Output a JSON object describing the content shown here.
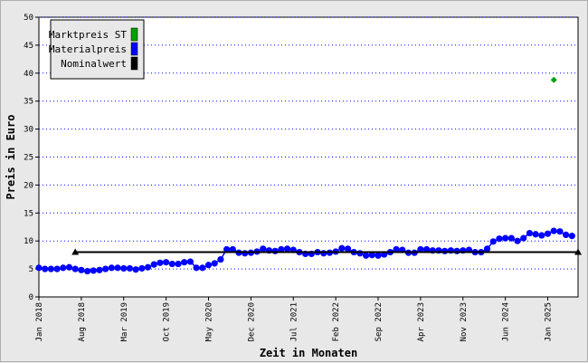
{
  "chart_data": {
    "type": "line",
    "xlabel": "Zeit in Monaten",
    "ylabel": "Preis in Euro",
    "ylim": [
      0,
      50
    ],
    "yticks": [
      0,
      5,
      10,
      15,
      20,
      25,
      30,
      35,
      40,
      45,
      50
    ],
    "grid": "horizontal dotted",
    "legend_position": "top-left",
    "x_tick_labels": [
      "Jan 2018",
      "Aug 2018",
      "Mar 2019",
      "Oct 2019",
      "May 2020",
      "Dec 2020",
      "Jul 2021",
      "Feb 2022",
      "Sep 2022",
      "Apr 2023",
      "Nov 2023",
      "Jun 2024",
      "Jan 2025"
    ],
    "x_start": "Jan 2018",
    "x_end": "Jun 2025",
    "series": [
      {
        "name": "Marktpreis ST",
        "color": "#00a000",
        "marker": "diamond",
        "points": [
          {
            "x": "Feb 2025",
            "y": 38.8
          }
        ]
      },
      {
        "name": "Materialpreis",
        "color": "#0000ff",
        "marker": "circle",
        "values": [
          5.2,
          5.0,
          5.0,
          5.0,
          5.2,
          5.3,
          5.0,
          4.8,
          4.6,
          4.7,
          4.8,
          5.0,
          5.2,
          5.2,
          5.1,
          5.1,
          4.9,
          5.1,
          5.3,
          5.8,
          6.1,
          6.2,
          5.9,
          5.9,
          6.2,
          6.3,
          5.2,
          5.2,
          5.7,
          6.0,
          6.7,
          8.5,
          8.5,
          7.9,
          7.8,
          7.9,
          8.1,
          8.6,
          8.3,
          8.2,
          8.5,
          8.6,
          8.4,
          8.0,
          7.7,
          7.7,
          8.0,
          7.8,
          7.9,
          8.1,
          8.7,
          8.6,
          8.0,
          7.8,
          7.4,
          7.5,
          7.4,
          7.6,
          8.0,
          8.5,
          8.4,
          7.9,
          7.9,
          8.5,
          8.5,
          8.3,
          8.3,
          8.2,
          8.3,
          8.2,
          8.3,
          8.4,
          8.0,
          8.0,
          8.6,
          9.9,
          10.4,
          10.5,
          10.5,
          10.0,
          10.5,
          11.4,
          11.2,
          11.0,
          11.3,
          11.8,
          11.7,
          11.1,
          10.9
        ]
      },
      {
        "name": "Nominalwert",
        "color": "#000000",
        "marker": "triangle",
        "points": [
          {
            "x": "Jul 2018",
            "y": 8.0
          },
          {
            "x": "Jun 2025",
            "y": 8.0
          }
        ]
      }
    ]
  }
}
